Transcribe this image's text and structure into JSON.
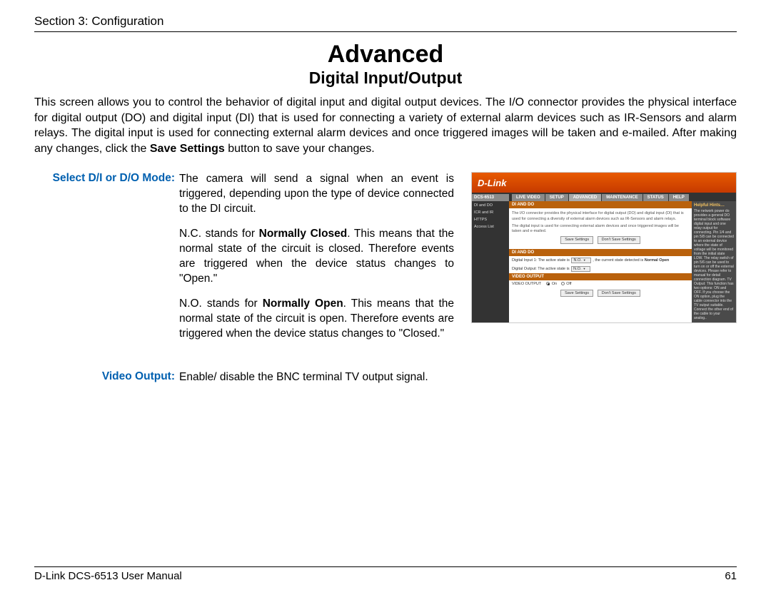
{
  "header": {
    "section": "Section 3: Configuration"
  },
  "titles": {
    "main": "Advanced",
    "sub": "Digital Input/Output"
  },
  "intro": {
    "t1": "This screen allows you to control the behavior of digital input and digital output devices. The I/O connector provides the physical interface for digital output (DO) and digital input (DI) that is used for connecting a variety of external alarm devices such as IR-Sensors and alarm relays. The digital input is used for connecting external alarm devices and once triggered images will be taken and e-mailed. After making any changes, click the ",
    "bold": "Save Settings",
    "t2": " button to save your changes."
  },
  "defs": {
    "mode_label": "Select D/I or D/O Mode:",
    "mode_p1": "The camera will send a signal when an event is triggered, depending upon the type of device connected to the DI circuit.",
    "mode_p2a": "N.C. stands for ",
    "mode_p2b": "Normally Closed",
    "mode_p2c": ". This means that the normal state of the circuit is closed. Therefore events are triggered when the device status changes to \"Open.\"",
    "mode_p3a": "N.O. stands for ",
    "mode_p3b": "Normally Open",
    "mode_p3c": ". This means that the normal state of the circuit is open. Therefore events are triggered when the device status changes to \"Closed.\"",
    "video_label": "Video Output:",
    "video_text": "Enable/ disable the BNC terminal TV output signal."
  },
  "shot": {
    "brand": "D-Link",
    "device": "DCS-6513",
    "nav": [
      "DI and DO",
      "ICR and IR",
      "HTTPS",
      "Access List"
    ],
    "tabs": [
      "LIVE VIDEO",
      "SETUP",
      "ADVANCED",
      "MAINTENANCE",
      "STATUS",
      "HELP"
    ],
    "panel1_h": "DI AND DO",
    "panel1_t1": "The I/O connector provides the physical interface for digital output (DO) and digital input (DI) that is used for connecting a diversity of external alarm devices such as IR-Sensors and alarm relays.",
    "panel1_t2": "The digital input is used for connecting external alarm devices and once triggered images will be taken and e-mailed.",
    "btn_save": "Save Settings",
    "btn_dont": "Don't Save Settings",
    "panel2_h": "DI AND DO",
    "di_line_a": "Digital Input 1: The active state is",
    "di_sel": "N.O.",
    "di_line_b": ", the current state detected is",
    "di_bold": "Normal Open",
    "do_line": "Digital Output: The active state is",
    "do_sel": "N.O.",
    "panel3_h": "VIDEO OUTPUT",
    "vo_label": "VIDEO OUTPUT",
    "vo_on": "On",
    "vo_off": "Off",
    "hints_h": "Helpful Hints…",
    "hints_t": "The network power do provides a general DO terminal block software digital input and one relay output for connecting. Pin 1/4 and pin 5/8 can be connected to an external device where the state of voltage will be monitored from the initial state LOW. The relay switch of pin 5/6 can be used to turn on or off the external devices. Please refer to manual for detail connection diagram. TV Output: This function has two options: ON and OFF. If you choose the ON option, plug the cable connector into the TV output suitable. Connect the other end of the cable to your analog.."
  },
  "footer": {
    "left": "D-Link DCS-6513 User Manual",
    "right": "61"
  }
}
